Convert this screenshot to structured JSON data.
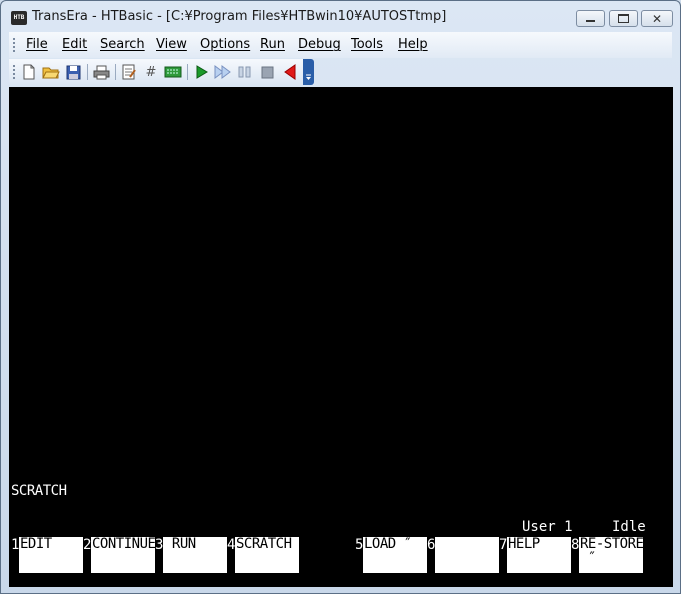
{
  "window": {
    "icon_text": "HTB",
    "title": "TransEra - HTBasic - [C:¥Program Files¥HTBwin10¥AUTOSTtmp]"
  },
  "menu": [
    "File",
    "Edit",
    "Search",
    "View",
    "Options",
    "Run",
    "Debug",
    "Tools",
    "Help"
  ],
  "toolbar": {
    "buttons": [
      "new-icon",
      "open-icon",
      "save-icon",
      "print-icon",
      "edit-document-icon",
      "hash-icon",
      "keyboard-icon",
      "run-icon",
      "continue-icon",
      "pause-icon",
      "stop-icon",
      "step-back-icon"
    ]
  },
  "terminal": {
    "last_line": "SCRATCH",
    "status_user": "User 1",
    "status_state": "Idle"
  },
  "softkeys": [
    {
      "num": "1",
      "label": "EDIT"
    },
    {
      "num": "2",
      "label": "CONTINUE"
    },
    {
      "num": "3",
      "label": " RUN"
    },
    {
      "num": "4",
      "label": "SCRATCH"
    },
    {
      "num": "5",
      "label": "LOAD ″"
    },
    {
      "num": "6",
      "label": ""
    },
    {
      "num": "7",
      "label": "HELP"
    },
    {
      "num": "8",
      "label": "RE-STORE\n ″"
    }
  ],
  "colors": {
    "screen_bg": "#000000",
    "screen_fg": "#ffffff",
    "softkey_bg": "#ffffff",
    "menubar_bg": "#e8eef7"
  }
}
